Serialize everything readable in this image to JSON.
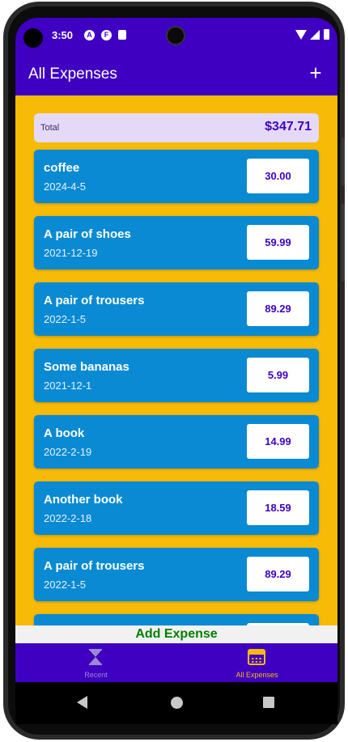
{
  "status_bar": {
    "time": "3:50",
    "icons": [
      "a-icon",
      "f-icon",
      "sd-card-icon",
      "wifi-icon",
      "signal-icon",
      "battery-icon"
    ],
    "badge_a": "A",
    "badge_f": "F"
  },
  "app_bar": {
    "title": "All Expenses",
    "add_icon": "+"
  },
  "summary": {
    "total_label": "Total",
    "total_value": "$347.71"
  },
  "expenses": [
    {
      "name": "coffee",
      "date": "2024-4-5",
      "amount": "30.00"
    },
    {
      "name": "A pair of shoes",
      "date": "2021-12-19",
      "amount": "59.99"
    },
    {
      "name": "A pair of trousers",
      "date": "2022-1-5",
      "amount": "89.29"
    },
    {
      "name": "Some bananas",
      "date": "2021-12-1",
      "amount": "5.99"
    },
    {
      "name": "A book",
      "date": "2022-2-19",
      "amount": "14.99"
    },
    {
      "name": "Another book",
      "date": "2022-2-18",
      "amount": "18.59"
    },
    {
      "name": "A pair of trousers",
      "date": "2022-1-5",
      "amount": "89.29"
    },
    {
      "name": "",
      "date": "",
      "amount": ""
    }
  ],
  "add_button": {
    "label": "Add Expense"
  },
  "bottom_nav": {
    "tabs": [
      {
        "label": "Recent",
        "icon": "hourglass-icon",
        "active": false
      },
      {
        "label": "All Expenses",
        "icon": "calendar-icon",
        "active": true
      }
    ]
  },
  "colors": {
    "primary": "#3f00c2",
    "content_background": "#f7bb07",
    "card": "#0a8ad2",
    "summary_background": "#e4daf8",
    "add_text": "#008000"
  }
}
